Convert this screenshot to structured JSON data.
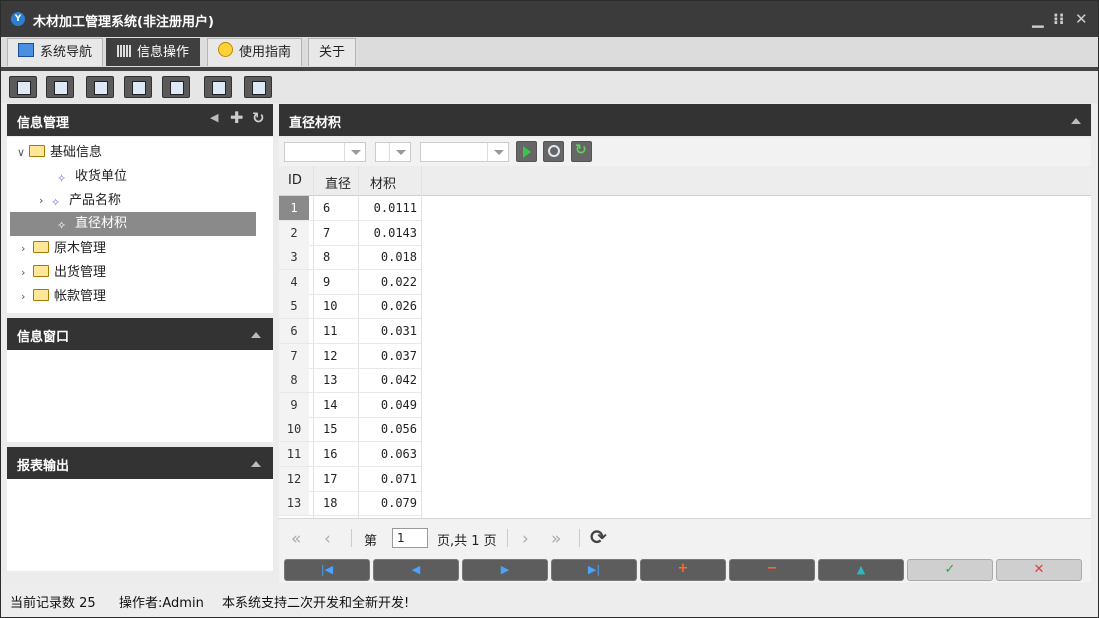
{
  "window": {
    "title": "木材加工管理系统(非注册用户)"
  },
  "tabs": [
    {
      "label": "系统导航",
      "icon": "monitor-icon"
    },
    {
      "label": "信息操作",
      "icon": "grid-icon",
      "active": true
    },
    {
      "label": "使用指南",
      "icon": "help-icon"
    },
    {
      "label": "关于"
    }
  ],
  "left": {
    "info_manage": {
      "title": "信息管理",
      "tree": [
        {
          "label": "基础信息",
          "type": "folder",
          "expanded": true
        },
        {
          "label": "收货单位",
          "type": "leaf"
        },
        {
          "label": "产品名称",
          "type": "leaf-collapsed"
        },
        {
          "label": "直径材积",
          "type": "leaf",
          "selected": true
        },
        {
          "label": "原木管理",
          "type": "folder"
        },
        {
          "label": "出货管理",
          "type": "folder"
        },
        {
          "label": "帐款管理",
          "type": "folder"
        }
      ]
    },
    "info_window": {
      "title": "信息窗口"
    },
    "report": {
      "title": "报表输出"
    }
  },
  "main": {
    "title": "直径材积",
    "columns": [
      "ID",
      "直径",
      "材积"
    ],
    "rows": [
      [
        "1",
        "6",
        "0.0111"
      ],
      [
        "2",
        "7",
        "0.0143"
      ],
      [
        "3",
        "8",
        "0.018"
      ],
      [
        "4",
        "9",
        "0.022"
      ],
      [
        "5",
        "10",
        "0.026"
      ],
      [
        "6",
        "11",
        "0.031"
      ],
      [
        "7",
        "12",
        "0.037"
      ],
      [
        "8",
        "13",
        "0.042"
      ],
      [
        "9",
        "14",
        "0.049"
      ],
      [
        "10",
        "15",
        "0.056"
      ],
      [
        "11",
        "16",
        "0.063"
      ],
      [
        "12",
        "17",
        "0.071"
      ],
      [
        "13",
        "18",
        "0.079"
      ]
    ],
    "pager": {
      "page_label": "第",
      "page_value": "1",
      "total_label": "页,共 1 页"
    }
  },
  "statusbar": {
    "record_count": "当前记录数 25",
    "operator": "操作者:Admin",
    "notice": "本系统支持二次开发和全新开发!"
  },
  "colors": {
    "dark_header": "#333333",
    "selected": "#8a8a8a",
    "accent_red": "#e23c3c",
    "accent_green": "#2aa84a"
  }
}
